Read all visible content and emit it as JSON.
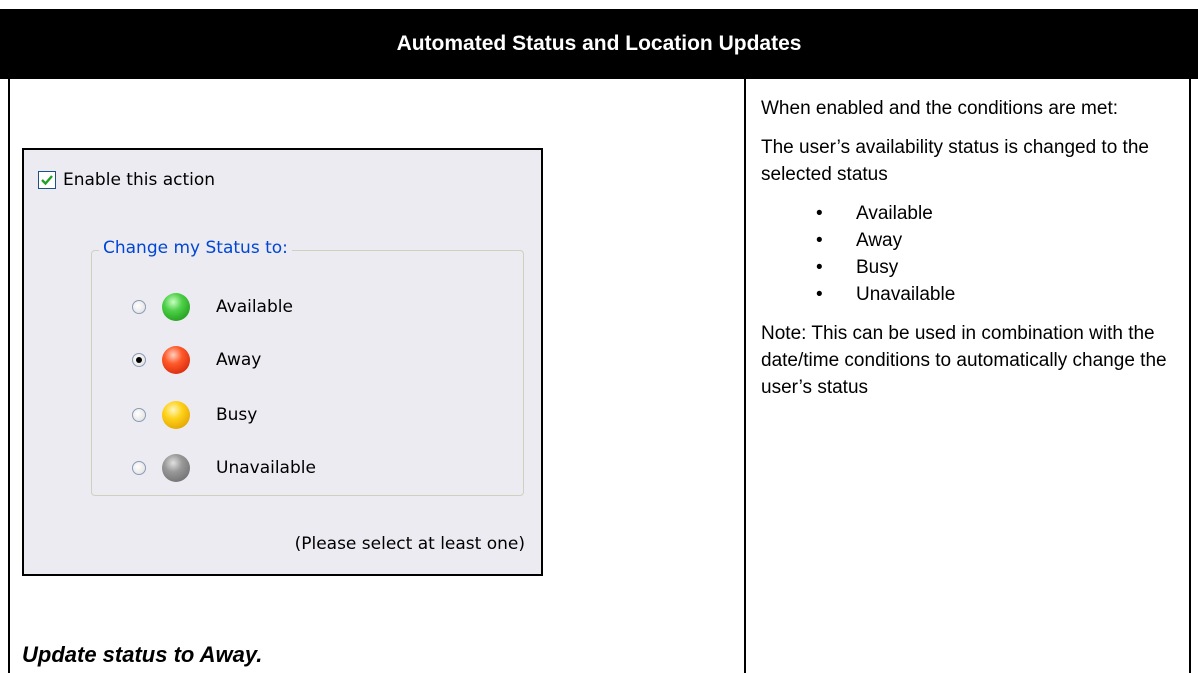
{
  "header": {
    "title": "Automated Status and Location Updates"
  },
  "dialog": {
    "enable_label": "Enable this action",
    "enable_checked": true,
    "group_label": "Change my Status to:",
    "options": [
      {
        "label": "Available",
        "icon": "green-status-orb-icon",
        "color": "#4fd04a",
        "selected": false
      },
      {
        "label": "Away",
        "icon": "red-status-orb-icon",
        "color": "#ff5a2a",
        "selected": true
      },
      {
        "label": "Busy",
        "icon": "yellow-status-orb-icon",
        "color": "#ffd21a",
        "selected": false
      },
      {
        "label": "Unavailable",
        "icon": "gray-status-orb-icon",
        "color": "#999999",
        "selected": false
      }
    ],
    "hint": "(Please select at least one)"
  },
  "caption": "Update status to Away.",
  "description": {
    "intro": "When enabled and the conditions are met:",
    "body": "The user’s availability status is changed to the selected status",
    "bullets": [
      "Available",
      "Away",
      "Busy",
      "Unavailable"
    ],
    "note": "Note: This can be used in combination with the date/time conditions to automatically change the user’s status"
  }
}
